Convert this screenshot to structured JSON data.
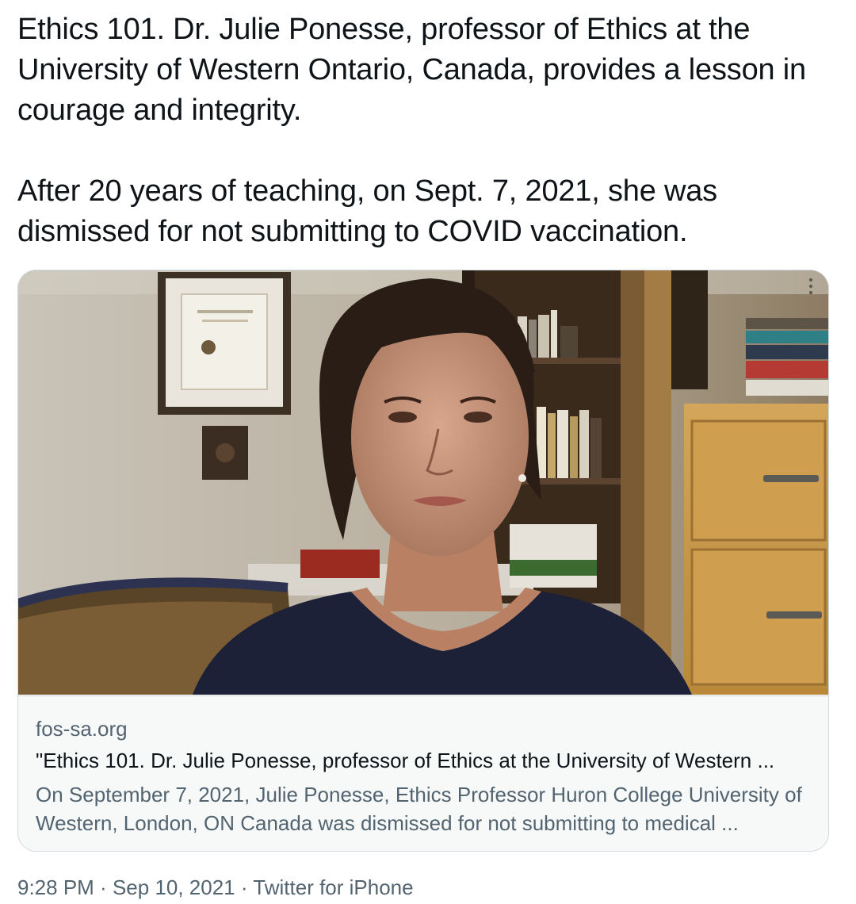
{
  "tweet": {
    "paragraph1": "Ethics 101. Dr. Julie Ponesse, professor of Ethics at the University of Western Ontario, Canada, provides a lesson in courage and integrity.",
    "paragraph2": "After 20 years of teaching, on Sept. 7, 2021,   she was dismissed for not submitting to COVID vaccination."
  },
  "card": {
    "domain": "fos-sa.org",
    "title": "\"Ethics 101. Dr. Julie Ponesse, professor of Ethics at the University of Western ...",
    "description": "On September 7, 2021, Julie Ponesse, Ethics Professor Huron College University of Western, London, ON Canada was dismissed for not submitting to medical ..."
  },
  "footer": {
    "time": "9:28 PM",
    "separator": " · ",
    "date": "Sep 10, 2021",
    "source": "Twitter for iPhone"
  }
}
